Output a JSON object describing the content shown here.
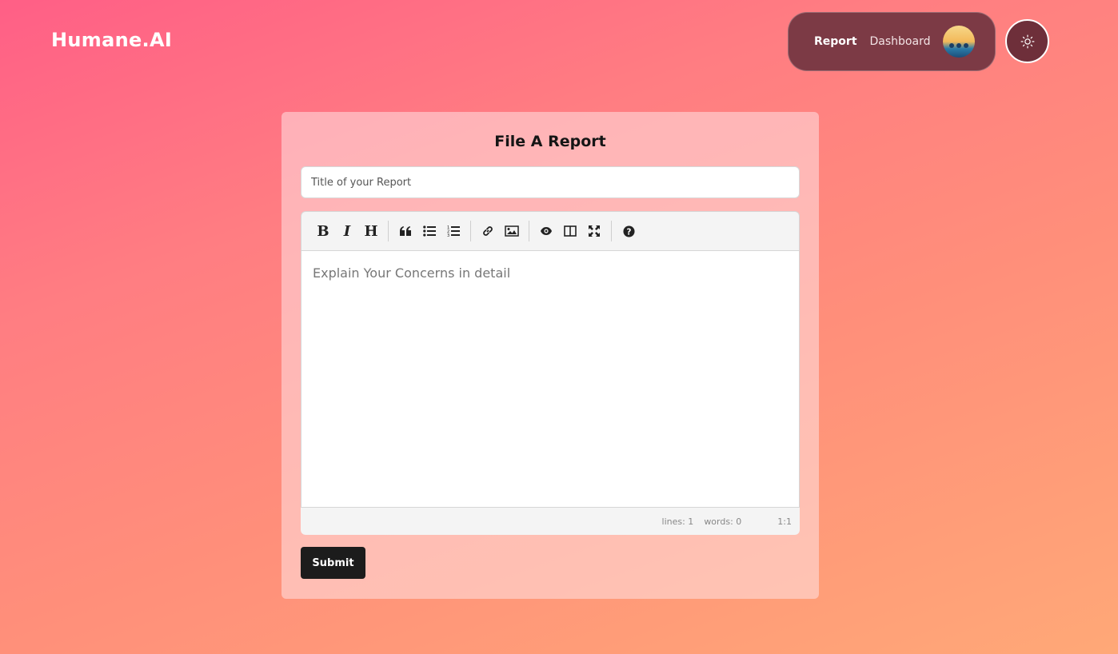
{
  "brand": {
    "name": "Humane.AI"
  },
  "nav": {
    "report_label": "Report",
    "dashboard_label": "Dashboard",
    "avatar_icon": "user-avatar",
    "theme_icon": "sun-icon"
  },
  "form": {
    "title": "File A Report",
    "title_placeholder": "Title of your Report",
    "editor_placeholder": "Explain Your Concerns in detail",
    "toolbar": [
      {
        "name": "bold",
        "icon": "bold-icon"
      },
      {
        "name": "italic",
        "icon": "italic-icon"
      },
      {
        "name": "heading",
        "icon": "heading-icon"
      },
      {
        "name": "quote",
        "icon": "quote-icon"
      },
      {
        "name": "unordered-list",
        "icon": "list-ul-icon"
      },
      {
        "name": "ordered-list",
        "icon": "list-ol-icon"
      },
      {
        "name": "link",
        "icon": "link-icon"
      },
      {
        "name": "image",
        "icon": "image-icon"
      },
      {
        "name": "preview",
        "icon": "eye-icon"
      },
      {
        "name": "side-by-side",
        "icon": "columns-icon"
      },
      {
        "name": "fullscreen",
        "icon": "fullscreen-icon"
      },
      {
        "name": "guide",
        "icon": "help-icon"
      }
    ],
    "status": {
      "lines": "lines: 1",
      "words": "words: 0",
      "cursor": "1:1"
    },
    "submit_label": "Submit"
  },
  "colors": {
    "gradient_start": "#ff5f86",
    "gradient_end": "#ffa877",
    "nav_pill": "#7c3a45",
    "submit_bg": "#1c1c1c"
  }
}
